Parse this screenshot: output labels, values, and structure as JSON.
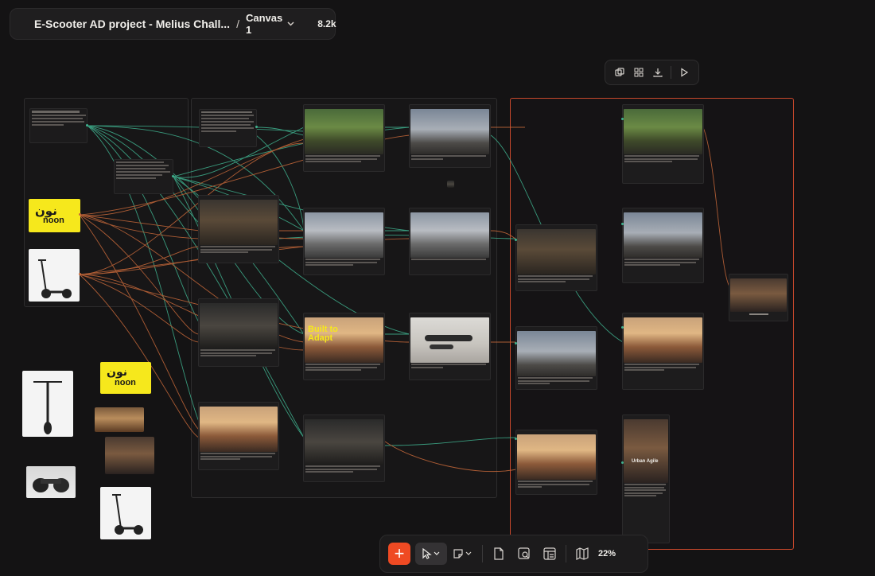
{
  "header": {
    "project_title": "E-Scooter AD project - Melius Chall...",
    "separator": "/",
    "canvas_name": "Canvas 1",
    "credits": "8.2k"
  },
  "icons": {
    "menu": "hamburger-icon",
    "chevron": "chevron-down-icon",
    "credits": "credits-coin-icon",
    "duplicate": "duplicate-icon",
    "grid": "grid-icon",
    "download": "download-icon",
    "play": "play-icon",
    "add": "plus-icon",
    "select": "cursor-icon",
    "sticky": "sticky-note-icon",
    "document": "document-icon",
    "image_search": "image-search-icon",
    "layout": "layout-icon",
    "map": "map-icon"
  },
  "bottom_toolbar": {
    "zoom": "22%"
  },
  "colors": {
    "accent": "#ef4a23",
    "selection_frame": "#c9482c",
    "wire_green": "#3fb28f",
    "wire_orange": "#c8693a",
    "noon_yellow": "#f6e81c"
  }
}
